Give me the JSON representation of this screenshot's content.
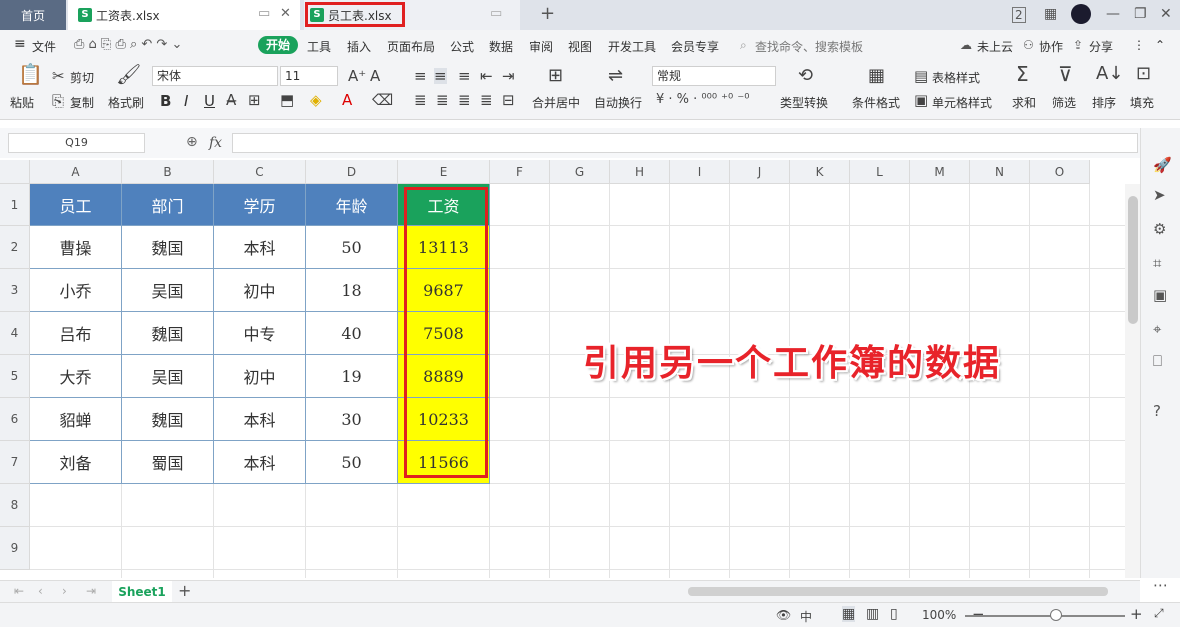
{
  "titlebar": {
    "home_tab": "首页",
    "file_tab": "工资表.xlsx",
    "file_tab2": "员工表.xlsx",
    "add_tab": "+",
    "window_min": "—",
    "window_restore": "❐",
    "window_close": "✕"
  },
  "menu": {
    "file": "文件",
    "items": [
      "开始",
      "工具",
      "插入",
      "页面布局",
      "公式",
      "数据",
      "审阅",
      "视图",
      "开发工具",
      "会员专享"
    ],
    "search": "查找命令、搜索模板",
    "cloud": "未上云",
    "collab": "协作",
    "share": "分享"
  },
  "ribbon": {
    "paste": "粘贴",
    "cut": "剪切",
    "copy": "复制",
    "format_painter": "格式刷",
    "font_name": "宋体",
    "font_size": "11",
    "number_format": "常规",
    "merge_center": "合并居中",
    "wrap_text": "自动换行",
    "type_convert": "类型转换",
    "cond_format": "条件格式",
    "table_style": "表格样式",
    "cell_style": "单元格样式",
    "sum": "求和",
    "filter": "筛选",
    "sort": "排序",
    "fill": "填充",
    "bold": "B",
    "italic": "I",
    "underline": "U"
  },
  "formula_bar": {
    "cell_ref": "Q19",
    "fx": "fx"
  },
  "grid": {
    "columns": [
      "A",
      "B",
      "C",
      "D",
      "E",
      "F",
      "G",
      "H",
      "I",
      "J",
      "K",
      "L",
      "M",
      "N",
      "O"
    ],
    "rows": [
      "1",
      "2",
      "3",
      "4",
      "5",
      "6",
      "7",
      "8",
      "9"
    ],
    "table": {
      "headers": [
        "员工",
        "部门",
        "学历",
        "年龄",
        "工资"
      ],
      "rows": [
        [
          "曹操",
          "魏国",
          "本科",
          "50",
          "13113"
        ],
        [
          "小乔",
          "吴国",
          "初中",
          "18",
          "9687"
        ],
        [
          "吕布",
          "魏国",
          "中专",
          "40",
          "7508"
        ],
        [
          "大乔",
          "吴国",
          "初中",
          "19",
          "8889"
        ],
        [
          "貂蝉",
          "魏国",
          "本科",
          "30",
          "10233"
        ],
        [
          "刘备",
          "蜀国",
          "本科",
          "50",
          "11566"
        ]
      ]
    }
  },
  "annotation": "引用另一个工作簿的数据",
  "sheet": {
    "name": "Sheet1",
    "add": "+"
  },
  "status": {
    "zoom": "100%",
    "zoom_minus": "−",
    "zoom_plus": "+"
  },
  "colors": {
    "accent_green": "#1aa25c",
    "header_blue": "#4f81bd",
    "highlight_yellow": "#ffff00",
    "annotation_red": "#e8232a"
  }
}
